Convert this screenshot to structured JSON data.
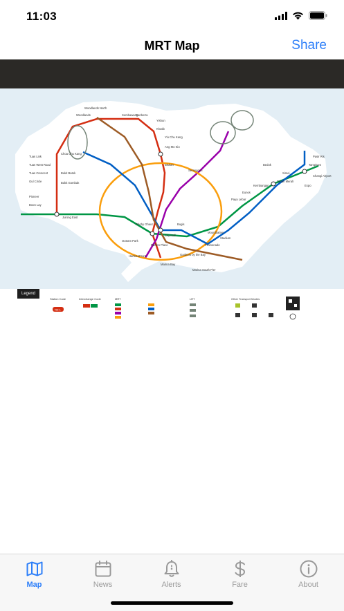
{
  "status": {
    "time": "11:03"
  },
  "nav": {
    "title": "MRT Map",
    "share_label": "Share"
  },
  "legend": {
    "title": "Legend",
    "headings": [
      "Station Code",
      "Interchange Code",
      "MRT",
      "LRT",
      "Other Transport Modes"
    ],
    "station_code_sample": "NS 1"
  },
  "map_labels": {
    "north": [
      "Woodlands North",
      "Woodlands",
      "Sembawang",
      "Canberra",
      "Yishun",
      "Khatib",
      "Yio Chu Kang",
      "Ang Mo Kio"
    ],
    "west": [
      "Tuas Link",
      "Tuas West Road",
      "Tuas Crescent",
      "Gul Circle",
      "Pioneer",
      "Boon Lay",
      "Jurong East",
      "Bukit Batok",
      "Bukit Gombak",
      "Choa Chu Kang"
    ],
    "east": [
      "Pasir Ris",
      "Tampines",
      "Simei",
      "Tanah Merah",
      "Expo",
      "Changi Airport",
      "Bedok",
      "Kembangan",
      "Eunos",
      "Paya Lebar"
    ],
    "central": [
      "Dhoby Ghaut",
      "City Hall",
      "Raffles Place",
      "Bugis",
      "Outram Park",
      "HarbourFront",
      "Marina Bay",
      "Promenade",
      "Serangoon",
      "Bishan"
    ],
    "south": [
      "Marina South Pier",
      "Gardens by the Bay",
      "Stadium",
      "Mountbatten"
    ]
  },
  "tabs": [
    {
      "label": "Map",
      "icon": "map-icon",
      "active": true
    },
    {
      "label": "News",
      "icon": "calendar-icon",
      "active": false
    },
    {
      "label": "Alerts",
      "icon": "bell-icon",
      "active": false
    },
    {
      "label": "Fare",
      "icon": "dollar-icon",
      "active": false
    },
    {
      "label": "About",
      "icon": "info-icon",
      "active": false
    }
  ],
  "colors": {
    "accent": "#2d7ff9",
    "ns_line": "#d42e12",
    "ew_line": "#009645",
    "ne_line": "#9900aa",
    "cc_line": "#fa9e0d",
    "dt_line": "#005ec4",
    "te_line": "#9d5b25",
    "lrt": "#748477"
  }
}
